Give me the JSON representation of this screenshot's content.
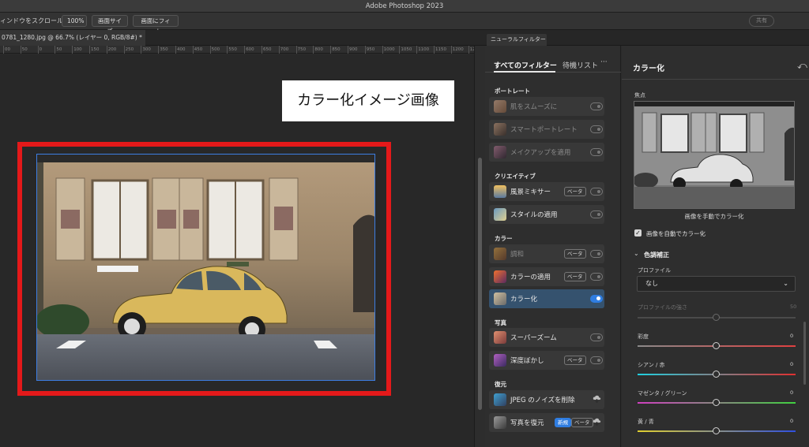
{
  "app": {
    "title": "Adobe Photoshop 2023"
  },
  "options_bar": {
    "scroll_all_windows": "ィンドウをスクロール",
    "zoom_100": "100%",
    "screen_size": "画面サイズ",
    "fit_screen": "画面にフィット",
    "share": "共有",
    "search_icon": "search-icon",
    "workspace_icon": "workspace-icon"
  },
  "document_tab": {
    "title": "0781_1280.jpg @ 66.7% (レイヤー 0, RGB/8#) *"
  },
  "ruler": {
    "ticks": [
      "00",
      "50",
      "0",
      "50",
      "100",
      "150",
      "200",
      "250",
      "300",
      "350",
      "400",
      "450",
      "500",
      "550",
      "600",
      "650",
      "700",
      "750",
      "800",
      "850",
      "900",
      "950",
      "1000",
      "1050",
      "1100",
      "1150",
      "1200",
      "1250"
    ]
  },
  "canvas": {
    "annotation_label": "カラー化イメージ画像",
    "highlight_color": "#e4191a",
    "selection_color": "#3d7ee3"
  },
  "neural_panel": {
    "tab_label": "ニューラルフィルター",
    "tabs": {
      "all": "すべてのフィルター",
      "waitlist": "待機リスト",
      "more": "···"
    },
    "sections": {
      "portrait": "ポートレート",
      "creative": "クリエイティブ",
      "color": "カラー",
      "photo": "写真",
      "restoration": "復元"
    },
    "beta_label": "ベータ",
    "new_label": "新規",
    "filters": {
      "skin_smoothing": "肌をスムーズに",
      "smart_portrait": "スマートポートレート",
      "makeup_transfer": "メイクアップを適用",
      "landscape_mixer": "風景ミキサー",
      "style_transfer": "スタイルの適用",
      "harmonization": "調和",
      "color_transfer": "カラーの適用",
      "colorize": "カラー化",
      "super_zoom": "スーパーズーム",
      "depth_blur": "深度ぼかし",
      "jpeg_artifacts": "JPEG のノイズを削除",
      "photo_restoration": "写真を復元"
    }
  },
  "colorize_panel": {
    "title": "カラー化",
    "focus_label": "焦点",
    "preview_caption": "画像を手動でカラー化",
    "auto_colorize": "画像を自動でカラー化",
    "adjustments_group": "色調補正",
    "profile_label": "プロファイル",
    "profile_value": "なし",
    "profile_strength_label": "プロファイルの強さ",
    "profile_strength_value": "50",
    "saturation_label": "彩度",
    "saturation_value": "0",
    "cyan_red_label": "シアン / 赤",
    "cyan_red_value": "0",
    "magenta_green_label": "マゼンタ / グリーン",
    "magenta_green_value": "0",
    "yellow_blue_label": "黄 / 青",
    "yellow_blue_value": "0"
  }
}
